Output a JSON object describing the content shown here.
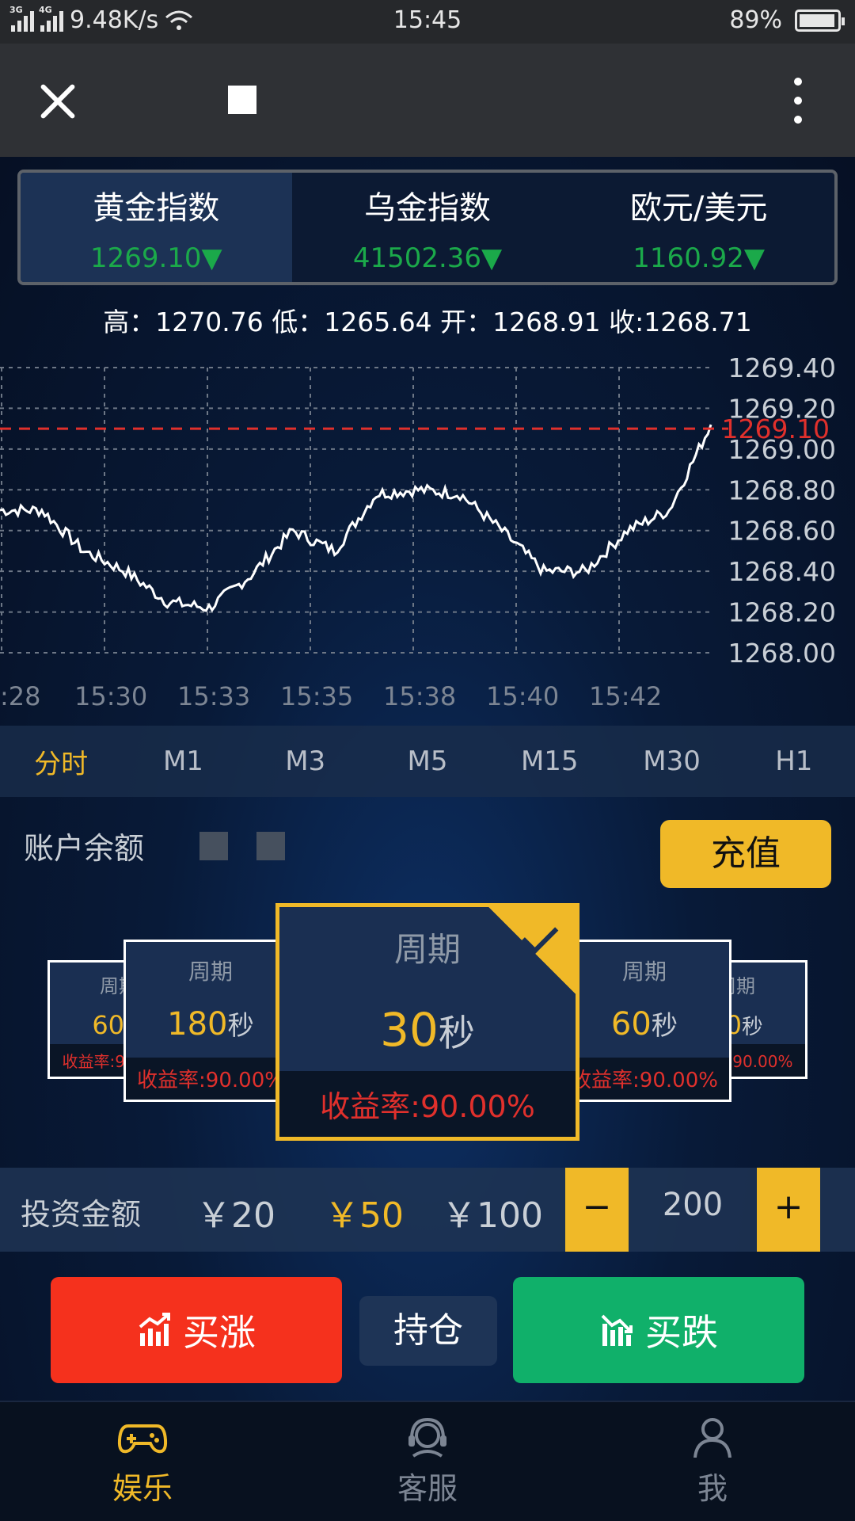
{
  "status_bar": {
    "network_1": "3G",
    "network_2": "4G",
    "speed": "9.48K/s",
    "time": "15:45",
    "battery": "89%"
  },
  "app_bar": {
    "close_icon": "close-icon",
    "more_icon": "more-vertical-icon"
  },
  "market_tabs": [
    {
      "name": "黄金指数",
      "value": "1269.10▼",
      "active": true
    },
    {
      "name": "乌金指数",
      "value": "41502.36▼",
      "active": false
    },
    {
      "name": "欧元/美元",
      "value": "1160.92▼",
      "active": false
    }
  ],
  "ohlc": "高：1270.76 低：1265.64 开：1268.91 收:1268.71",
  "chart_data": {
    "type": "line",
    "y_ticks": [
      "1269.40",
      "1269.20",
      "1269.00",
      "1268.80",
      "1268.60",
      "1268.40",
      "1268.20",
      "1268.00"
    ],
    "x_ticks": [
      ":28",
      "15:30",
      "15:33",
      "15:35",
      "15:38",
      "15:40",
      "15:42"
    ],
    "current_price_label": "1269.10",
    "current_price": 1269.1,
    "ylim": [
      1268.0,
      1269.4
    ],
    "grid": true,
    "series": [
      {
        "x": [
          "15:28",
          "15:29",
          "15:30",
          "15:31",
          "15:32",
          "15:33",
          "15:34",
          "15:35",
          "15:36",
          "15:37",
          "15:38",
          "15:39",
          "15:40",
          "15:41",
          "15:42",
          "15:43",
          "15:44",
          "15:45"
        ],
        "values": [
          1268.7,
          1268.7,
          1268.5,
          1268.4,
          1268.25,
          1268.22,
          1268.38,
          1268.6,
          1268.5,
          1268.78,
          1268.8,
          1268.78,
          1268.6,
          1268.4,
          1268.4,
          1268.6,
          1268.7,
          1269.12
        ]
      }
    ]
  },
  "timeframes": [
    "分时",
    "M1",
    "M3",
    "M5",
    "M15",
    "M30",
    "H1"
  ],
  "active_timeframe": "分时",
  "account": {
    "balance_label": "账户余额",
    "recharge_label": "充值"
  },
  "period_cards": [
    {
      "label": "周期",
      "number": "60",
      "unit": "秒",
      "rate": "收益率:90.00%"
    },
    {
      "label": "周期",
      "number": "180",
      "unit": "秒",
      "rate": "收益率:90.00%"
    },
    {
      "label": "周期",
      "number": "30",
      "unit": "秒",
      "rate": "收益率:90.00%",
      "selected": true
    },
    {
      "label": "周期",
      "number": "60",
      "unit": "秒",
      "rate": "收益率:90.00%"
    },
    {
      "label": "周期",
      "number": "90",
      "unit": "秒",
      "rate": "收益率:90.00%"
    }
  ],
  "investment": {
    "label": "投资金额",
    "amounts": [
      "￥20",
      "￥50",
      "￥100"
    ],
    "selected_amount": "￥50",
    "minus": "−",
    "plus": "+",
    "value": "200"
  },
  "actions": {
    "buy_up": "买涨",
    "hold": "持仓",
    "buy_down": "买跌",
    "buy_up_icon": "chart-up-icon",
    "buy_down_icon": "chart-down-icon"
  },
  "bottom_nav": [
    {
      "label": "娱乐",
      "icon": "gamepad-icon",
      "active": true
    },
    {
      "label": "客服",
      "icon": "headset-icon",
      "active": false
    },
    {
      "label": "我",
      "icon": "user-icon",
      "active": false
    }
  ],
  "colors": {
    "accent": "#f0b928",
    "up": "#f5311d",
    "down": "#10b06a",
    "price_down": "#1ba94a",
    "price_line": "#e0302c"
  }
}
